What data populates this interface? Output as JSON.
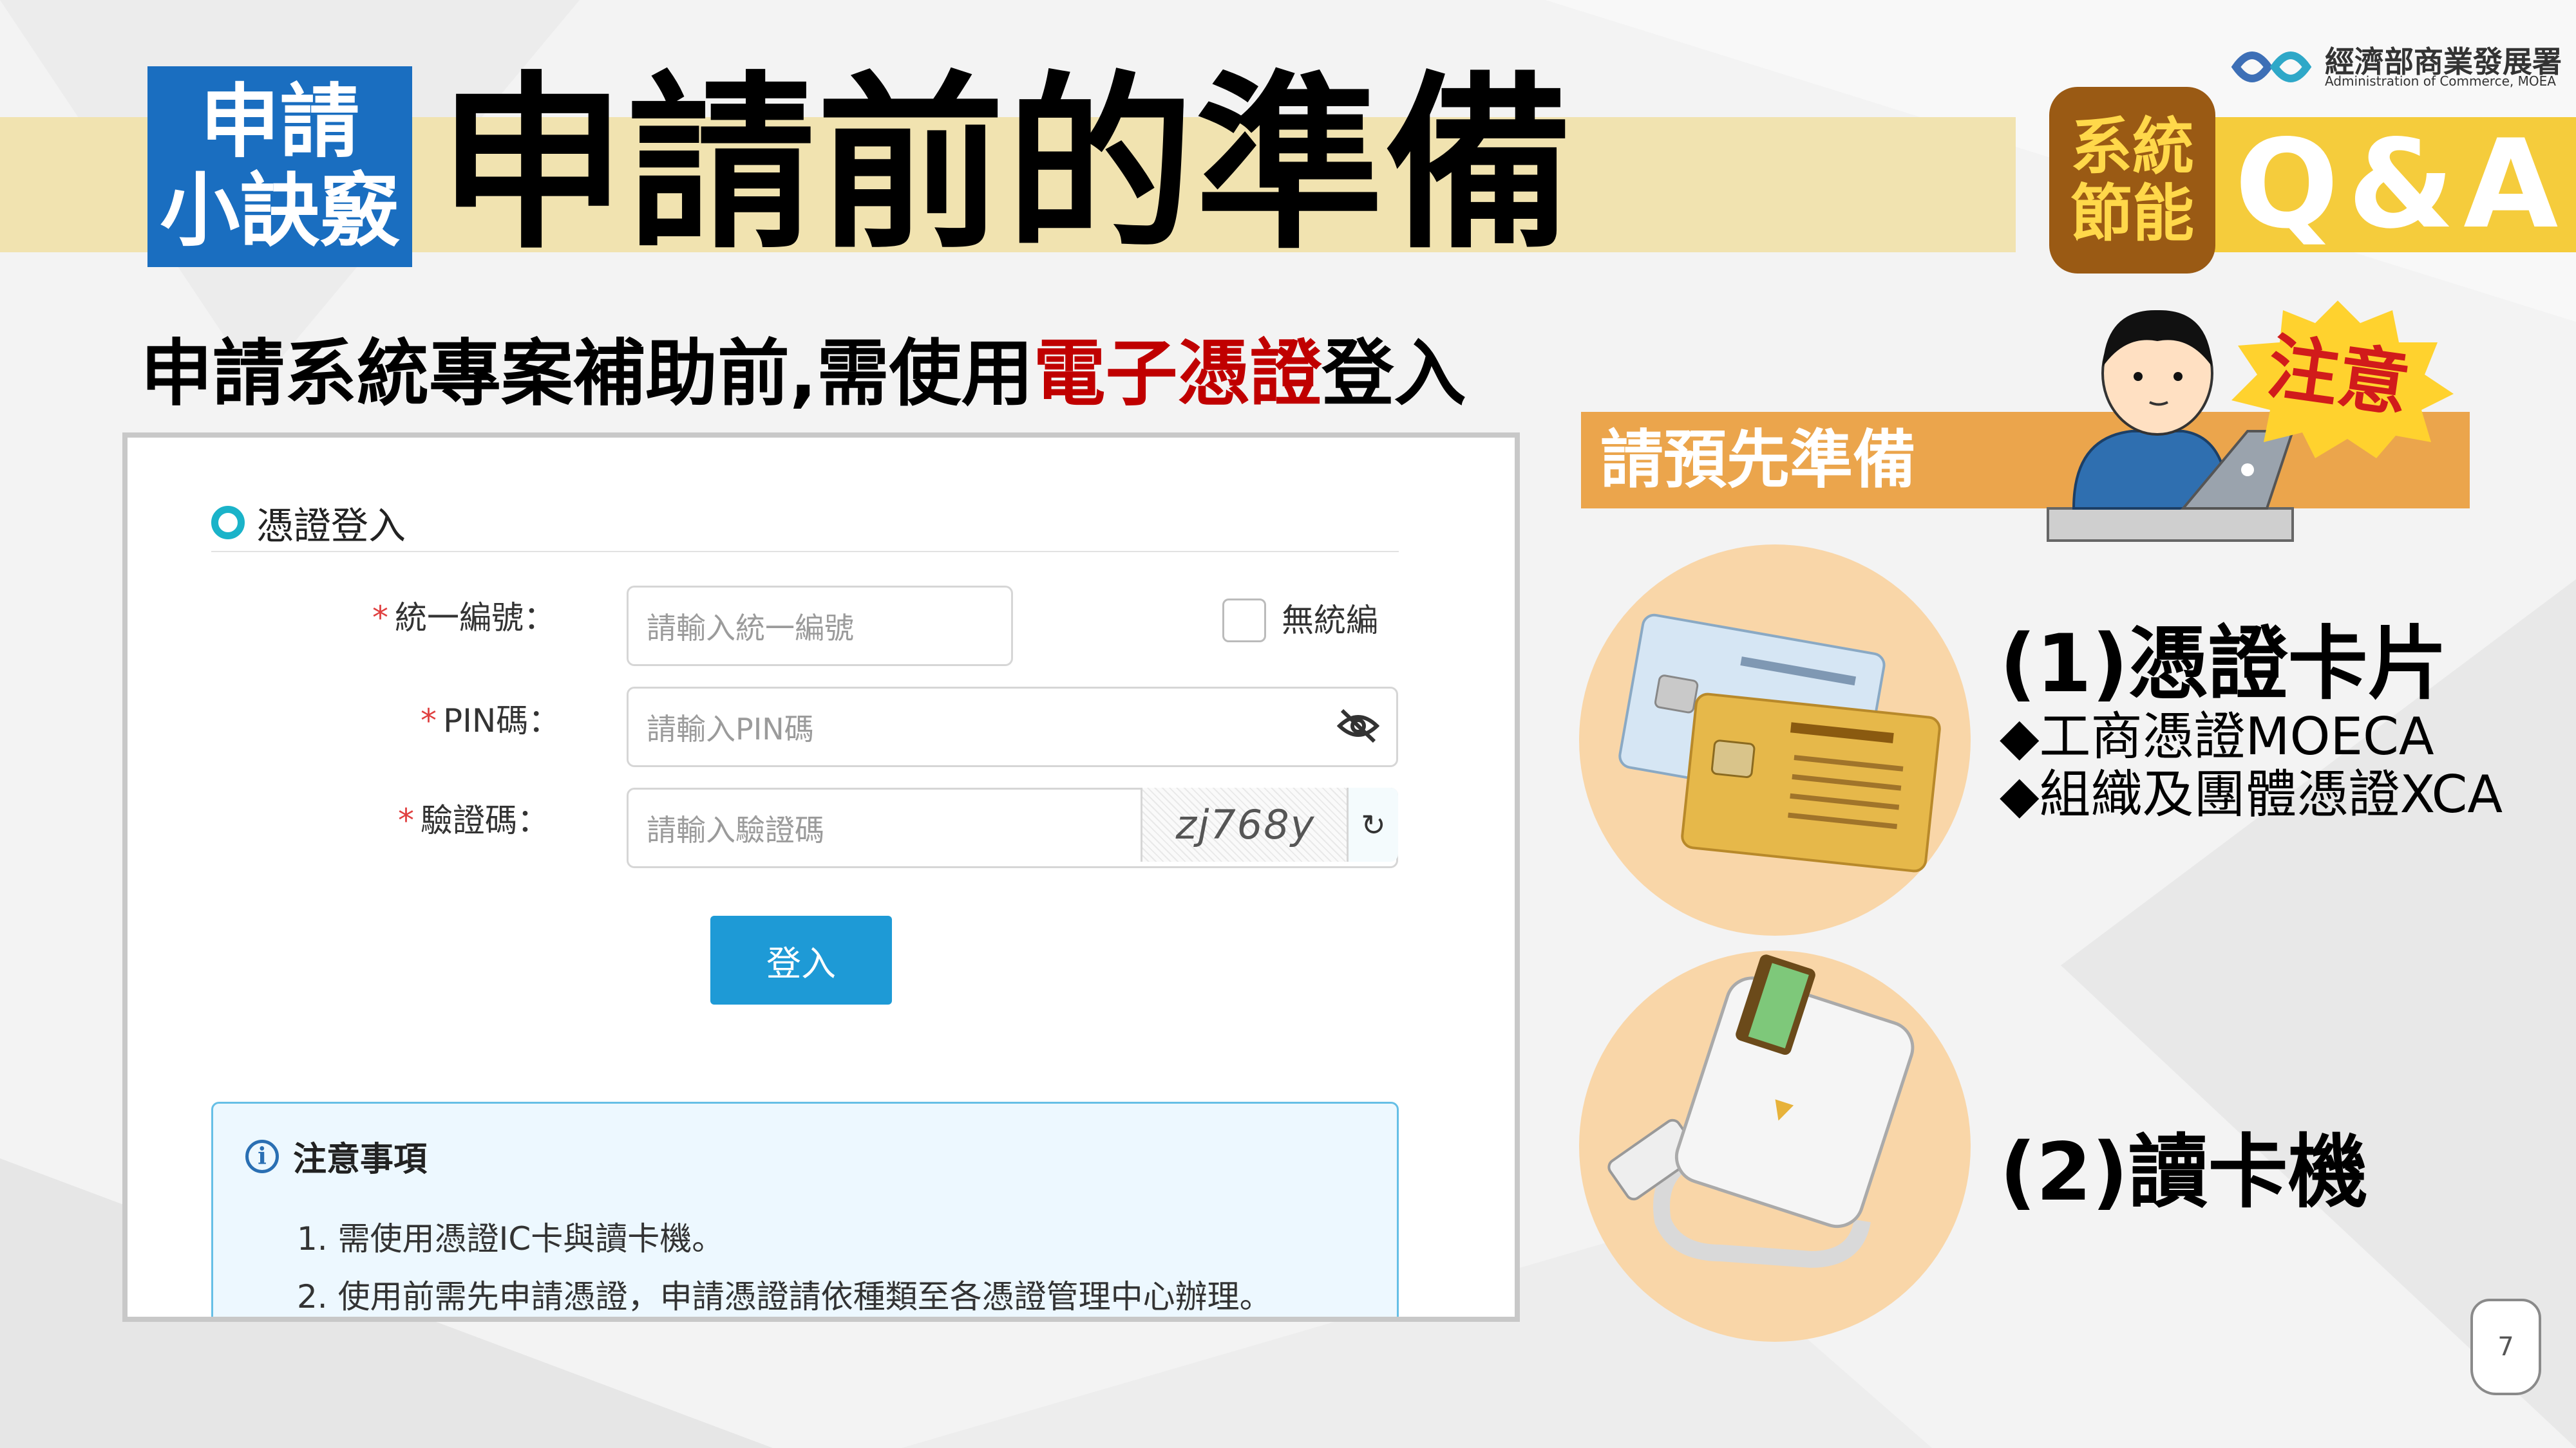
{
  "header": {
    "tips_line1": "申請",
    "tips_line2": "小訣竅",
    "title": "申請前的準備",
    "system_line1": "系統",
    "system_line2": "節能",
    "qa": "Q&A",
    "logo_zh": "經濟部商業發展署",
    "logo_en": "Administration of Commerce, MOEA"
  },
  "subtitle": {
    "prefix": "申請系統專案補助前,需使用",
    "highlight": "電子憑證",
    "suffix": "登入"
  },
  "login": {
    "heading": "憑證登入",
    "required_mark": "*",
    "tax_id_label": "統一編號：",
    "tax_id_placeholder": "請輸入統一編號",
    "no_tax_id_label": "無統編",
    "pin_label": "PIN碼：",
    "pin_placeholder": "請輸入PIN碼",
    "captcha_label": "驗證碼：",
    "captcha_placeholder": "請輸入驗證碼",
    "captcha_text": "zj768y",
    "login_button": "登入",
    "notice_title": "注意事項",
    "notice_items": [
      "1. 需使用憑證IC卡與讀卡機。",
      "2. 使用前需先申請憑證，申請憑證請依種類至各憑證管理中心辦理。"
    ]
  },
  "prepare": {
    "heading": "請預先準備",
    "caution": "注意",
    "item1_title": "(1)憑證卡片",
    "item1_subs": [
      "◆工商憑證MOECA",
      "◆組織及團體憑證XCA"
    ],
    "item2_title": "(2)讀卡機"
  },
  "page_number": "7",
  "colors": {
    "blue_badge": "#1a6ec0",
    "header_bar": "#f1e3b0",
    "qa_bar": "#f5cc3c",
    "system_badge": "#9a5a14",
    "highlight_red": "#c00000",
    "prepare_bar": "#eba54c",
    "circle": "#f9d6a8",
    "login_button": "#1e9ad6"
  }
}
